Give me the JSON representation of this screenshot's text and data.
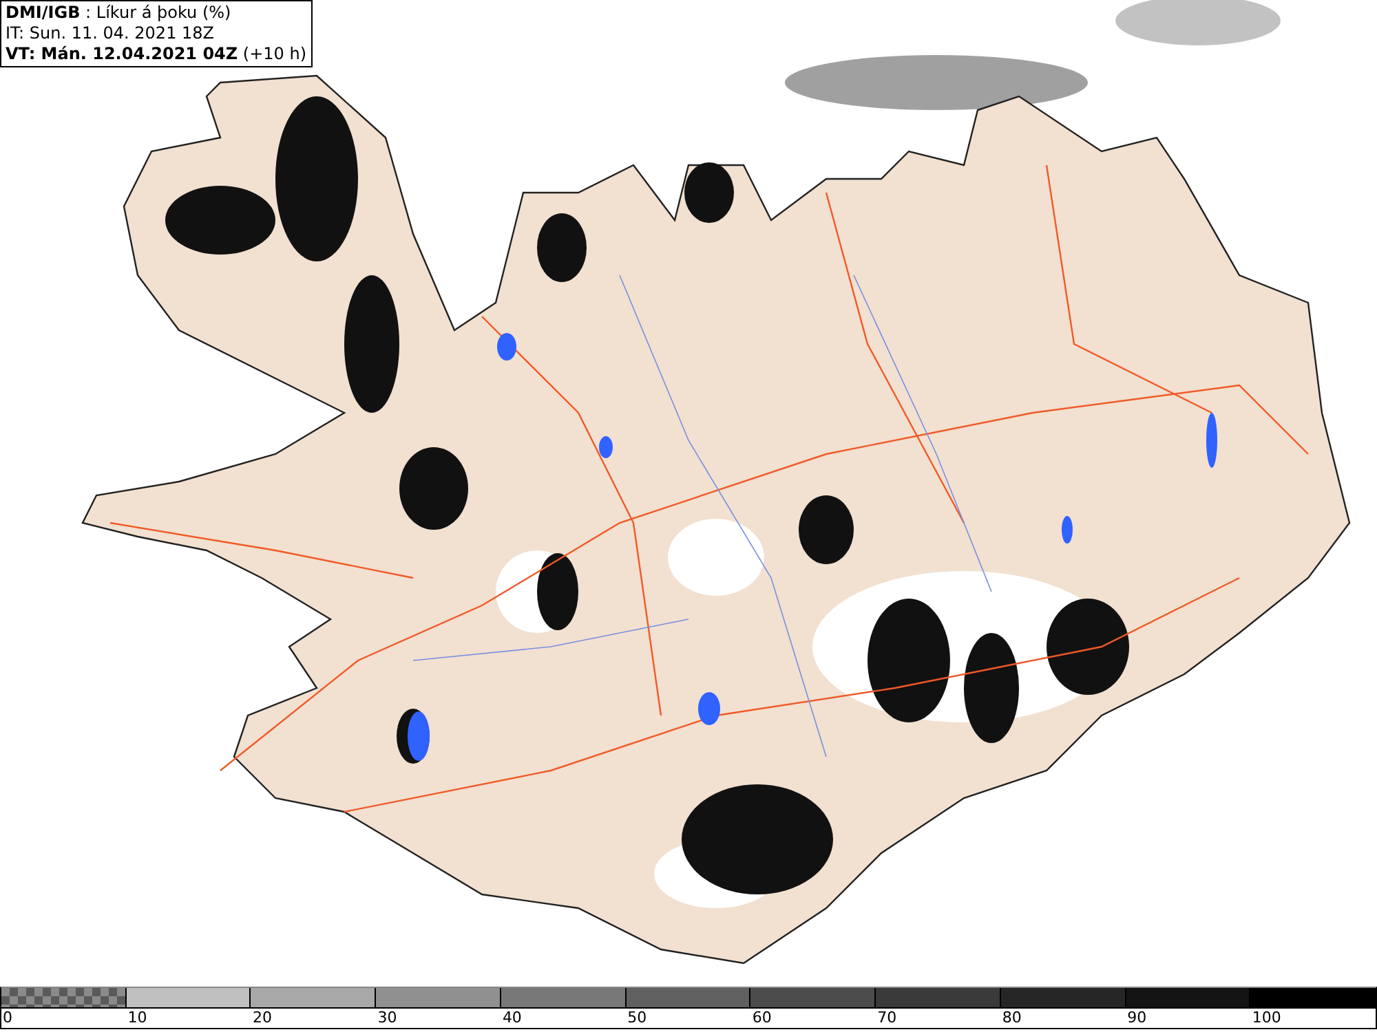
{
  "header": {
    "title": "**DMI/IGB** : Líkur á þoku (%)",
    "issue_time": "IT: Sun. 11. 04. 2021 18Z",
    "valid_time": "**VT: Mán. 12.04.2021 04Z** (+10 h)"
  },
  "legend": [
    {
      "label": "0",
      "kind": "checkered",
      "color": "#5a5a5a"
    },
    {
      "label": "10",
      "kind": "solid",
      "color": "#c0c0c0"
    },
    {
      "label": "20",
      "kind": "solid",
      "color": "#a8a8a8"
    },
    {
      "label": "30",
      "kind": "solid",
      "color": "#909090"
    },
    {
      "label": "40",
      "kind": "solid",
      "color": "#787878"
    },
    {
      "label": "50",
      "kind": "solid",
      "color": "#606060"
    },
    {
      "label": "60",
      "kind": "solid",
      "color": "#4c4c4c"
    },
    {
      "label": "70",
      "kind": "solid",
      "color": "#3a3a3a"
    },
    {
      "label": "80",
      "kind": "solid",
      "color": "#262626"
    },
    {
      "label": "90",
      "kind": "solid",
      "color": "#141414"
    },
    {
      "label": "100",
      "kind": "solid",
      "color": "#000000"
    }
  ]
}
